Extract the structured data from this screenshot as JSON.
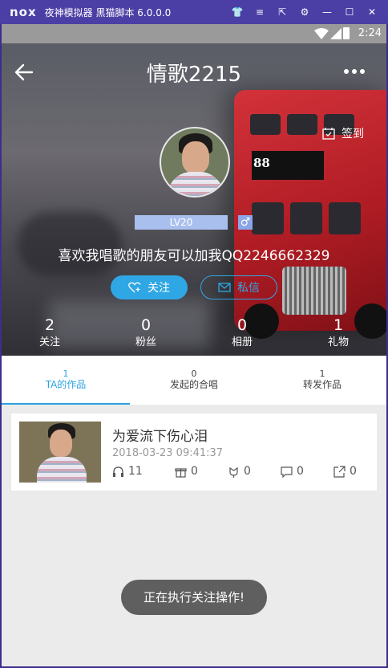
{
  "emulator": {
    "logo": "nox",
    "title": "夜神模拟器 黑猫脚本 6.0.0.0"
  },
  "statusbar": {
    "time": "2:24"
  },
  "header": {
    "title": "情歌2215",
    "checkin_label": "签到"
  },
  "profile": {
    "level": "LV20",
    "gender_symbol": "♂",
    "signature": "喜欢我唱歌的朋友可以加我QQ2246662329",
    "follow_label": "关注",
    "message_label": "私信"
  },
  "stats": [
    {
      "count": "2",
      "label": "关注"
    },
    {
      "count": "0",
      "label": "粉丝"
    },
    {
      "count": "0",
      "label": "相册"
    },
    {
      "count": "1",
      "label": "礼物"
    }
  ],
  "tabs": [
    {
      "count": "1",
      "label": "TA的作品",
      "active": true
    },
    {
      "count": "0",
      "label": "发起的合唱",
      "active": false
    },
    {
      "count": "1",
      "label": "转发作品",
      "active": false
    }
  ],
  "work": {
    "title": "为爱流下伤心泪",
    "date": "2018-03-23 09:41:37",
    "listens": "11",
    "gifts": "0",
    "flowers": "0",
    "comments": "0",
    "shares": "0"
  },
  "toast": "正在执行关注操作!",
  "colors": {
    "accent": "#2fa7e4",
    "emulator_bar": "#4b3fa5",
    "level_badge": "#a9c0ef"
  }
}
